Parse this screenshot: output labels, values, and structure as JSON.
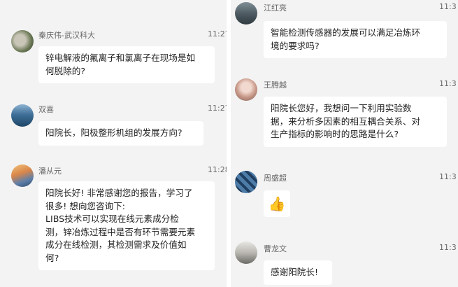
{
  "left_messages": [
    {
      "sender": "秦庆伟-武汉科大",
      "time": "11:27",
      "lines": [
        "锌电解液的氟离子和氯离子在现场是如",
        "何脱除的?"
      ],
      "avatar": "avatar-photo"
    },
    {
      "sender": "双喜",
      "time": "11:27",
      "lines": [
        "阳院长，阳极整形机组的发展方向?"
      ],
      "avatar": "avatar-photo"
    },
    {
      "sender": "潘从元",
      "time": "11:28",
      "lines": [
        "阳院长好! 非常感谢您的报告，学习了",
        "很多! 想向您咨询下:",
        "LIBS技术可以实现在线元素成分检",
        "测，锌冶炼过程中是否有环节需要元素",
        "成分在线检测，其检测需求及价值如",
        "何?"
      ],
      "avatar": "avatar-photo"
    }
  ],
  "right_messages": [
    {
      "sender": "江红亮",
      "time": "11:3",
      "lines": [
        "智能检测传感器的发展可以满足冶炼环",
        "境的要求吗?"
      ],
      "avatar": "avatar-photo"
    },
    {
      "sender": "王腾越",
      "time": "11:3",
      "lines": [
        "阳院长您好，我想问一下利用实验数",
        "据，来分析多因素的相互耦合关系、对",
        "生产指标的影响时的思路是什么?"
      ],
      "avatar": "avatar-photo"
    },
    {
      "sender": "周盛超",
      "time": "11:3",
      "lines": [],
      "emoji": "👍",
      "avatar": "avatar-photo"
    },
    {
      "sender": "曹龙文",
      "time": "11:3",
      "lines": [
        "感谢阳院长!"
      ],
      "avatar": "avatar-photo"
    }
  ],
  "icons": {
    "thumbs_up": "thumbs-up-icon"
  }
}
